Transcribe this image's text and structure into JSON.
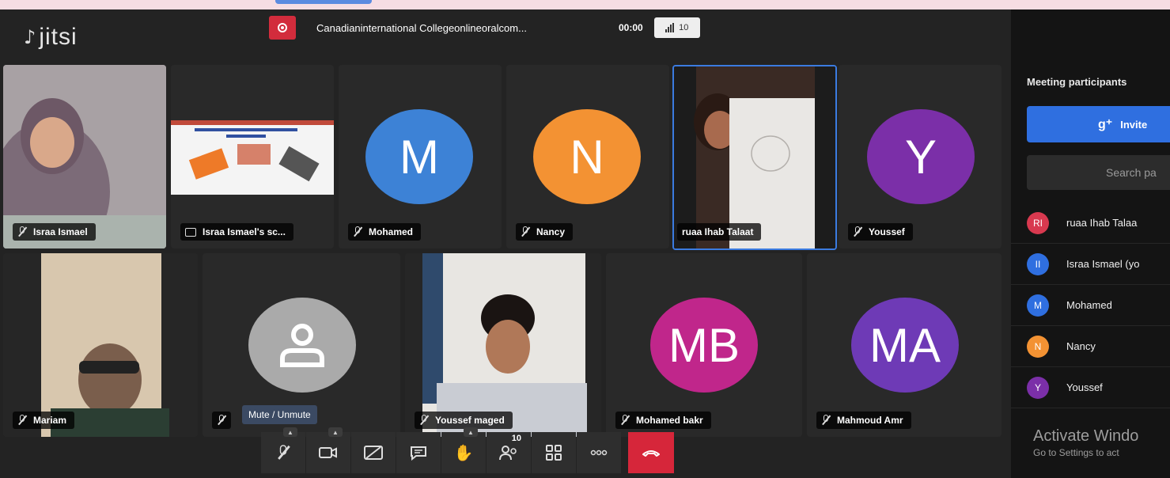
{
  "app": {
    "logo": "jitsi",
    "logo_icon": "jitsi-logo-icon"
  },
  "header": {
    "meeting_title": "Canadianinternational Collegeonlineoralcom...",
    "timer": "00:00",
    "participant_count": "10",
    "record_icon": "record-icon"
  },
  "tiles": [
    {
      "name": "Israa Ismael",
      "type": "camera",
      "mic": "muted"
    },
    {
      "name": "Israa Ismael's sc...",
      "type": "screenshare"
    },
    {
      "name": "Mohamed",
      "type": "avatar",
      "initials": "M",
      "color": "#3d82d6"
    },
    {
      "name": "Nancy",
      "type": "avatar",
      "initials": "N",
      "color": "#f39233"
    },
    {
      "name": "ruaa Ihab Talaat",
      "type": "camera",
      "active_speaker": true
    },
    {
      "name": "Youssef",
      "type": "avatar",
      "initials": "Y",
      "color": "#7b2fa8"
    },
    {
      "name": "Mariam",
      "type": "camera",
      "mic": "muted"
    },
    {
      "name": "",
      "type": "avatar-generic",
      "color": "#aaaaaa"
    },
    {
      "name": "Youssef maged",
      "type": "camera",
      "mic": "muted"
    },
    {
      "name": "Mohamed bakr",
      "type": "avatar",
      "initials": "MB",
      "color": "#c0268b"
    },
    {
      "name": "Mahmoud Amr",
      "type": "avatar",
      "initials": "MA",
      "color": "#6e3ab6"
    }
  ],
  "tooltip": "Mute / Unmute",
  "toolbar": {
    "items": [
      {
        "name": "microphone",
        "icon": "mic-off-icon"
      },
      {
        "name": "camera",
        "icon": "camera-icon"
      },
      {
        "name": "screen-share",
        "icon": "screen-share-icon"
      },
      {
        "name": "chat",
        "icon": "chat-icon"
      },
      {
        "name": "raise-hand",
        "icon": "hand-icon"
      },
      {
        "name": "participants",
        "icon": "participants-icon",
        "badge": "10"
      },
      {
        "name": "tile-view",
        "icon": "grid-icon"
      },
      {
        "name": "more",
        "icon": "more-icon"
      },
      {
        "name": "hangup",
        "icon": "hangup-icon",
        "color": "#d6263a"
      }
    ]
  },
  "sidebar": {
    "title": "Meeting participants",
    "invite_label": "Invite",
    "search_placeholder": "Search pa",
    "participants": [
      {
        "initials": "RI",
        "name": "ruaa Ihab Talaa",
        "color": "#d8394f"
      },
      {
        "initials": "II",
        "name": "Israa Ismael (yo",
        "color": "#2f6fe0"
      },
      {
        "initials": "M",
        "name": "Mohamed",
        "color": "#2f6fe0"
      },
      {
        "initials": "N",
        "name": "Nancy",
        "color": "#f39233"
      },
      {
        "initials": "Y",
        "name": "Youssef",
        "color": "#7b2fa8"
      }
    ]
  },
  "watermark": {
    "line1": "Activate Windo",
    "line2": "Go to Settings to act"
  }
}
